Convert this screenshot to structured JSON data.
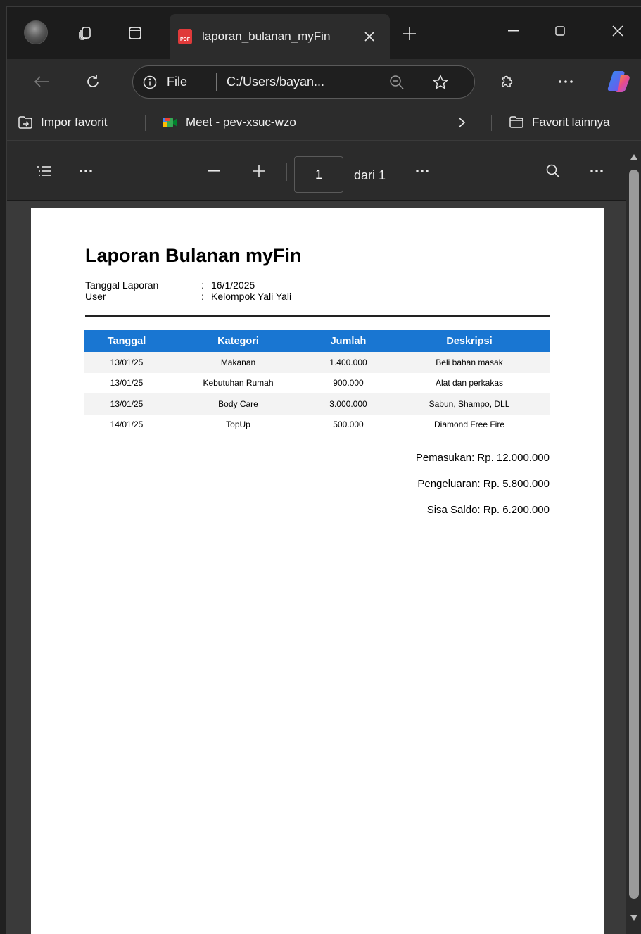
{
  "browser": {
    "tab": {
      "title": "laporan_bulanan_myFin",
      "icon": "pdf-icon"
    },
    "window_controls": {
      "minimize": "minimize-icon",
      "maximize": "maximize-icon",
      "close": "close-icon"
    },
    "address": {
      "scheme": "File",
      "url": "C:/Users/bayan...",
      "info_icon": "info-icon"
    },
    "bookmarks": [
      {
        "label": "Impor favorit",
        "icon": "import-favorites-icon"
      },
      {
        "label": "Meet - pev-xsuc-wzo",
        "icon": "google-meet-icon"
      }
    ],
    "other_favorites": "Favorit lainnya"
  },
  "pdf_toolbar": {
    "page_number": "1",
    "page_of": "dari 1"
  },
  "document": {
    "title": "Laporan Bulanan myFin",
    "meta": [
      {
        "key": "Tanggal Laporan",
        "sep": ":",
        "value": "16/1/2025"
      },
      {
        "key": "User",
        "sep": ":",
        "value": "Kelompok Yali Yali"
      }
    ],
    "table": {
      "headers": [
        "Tanggal",
        "Kategori",
        "Jumlah",
        "Deskripsi"
      ],
      "rows": [
        [
          "13/01/25",
          "Makanan",
          "1.400.000",
          "Beli bahan masak"
        ],
        [
          "13/01/25",
          "Kebutuhan Rumah",
          "900.000",
          "Alat dan perkakas"
        ],
        [
          "13/01/25",
          "Body Care",
          "3.000.000",
          "Sabun, Shampo, DLL"
        ],
        [
          "14/01/25",
          "TopUp",
          "500.000",
          "Diamond Free Fire"
        ]
      ],
      "header_color": "#1976d2"
    },
    "summary": {
      "income": "Pemasukan: Rp. 12.000.000",
      "expense": "Pengeluaran: Rp. 5.800.000",
      "balance": "Sisa Saldo: Rp. 6.200.000"
    }
  }
}
